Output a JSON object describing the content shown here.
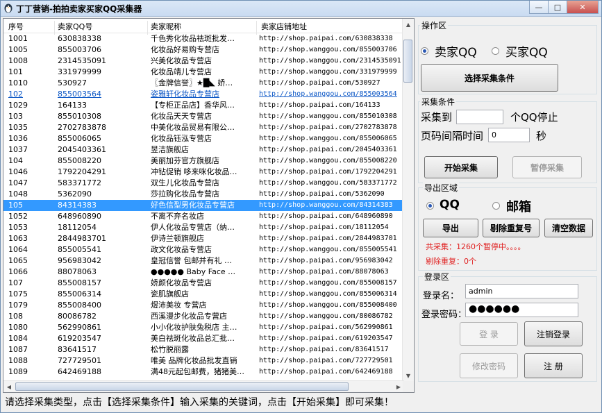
{
  "window": {
    "title": "丁丁营销-拍拍卖家买家QQ采集器"
  },
  "table": {
    "headers": [
      "序号",
      "卖家QQ号",
      "卖家昵称",
      "卖家店铺地址"
    ],
    "rows": [
      [
        "1001",
        "630838338",
        "千色秀化妆品祛斑批发…",
        "http://shop.paipai.com/630838338"
      ],
      [
        "1005",
        "855003706",
        "化妆品好易购专营店",
        "http://shop.wanggou.com/855003706"
      ],
      [
        "1008",
        "2314535091",
        "兴美化妆品专营店",
        "http://shop.wanggou.com/2314535091"
      ],
      [
        "101",
        "331979999",
        "化妆品靖儿专营店",
        "http://shop.wanggou.com/331979999"
      ],
      [
        "1010",
        "530927",
        "〖金牌信誉〗★█◣ 娇…",
        "http://shop.paipai.com/530927"
      ],
      [
        "102",
        "855003564",
        "姿雅轩化妆品专营店",
        "http://shop.wanggou.com/855003564"
      ],
      [
        "1029",
        "164133",
        "【专柜正品店】香华风…",
        "http://shop.paipai.com/164133"
      ],
      [
        "103",
        "855010308",
        "化妆品天天专营店",
        "http://shop.wanggou.com/855010308"
      ],
      [
        "1035",
        "2702783878",
        "中美化妆品贸易有限公…",
        "http://shop.paipai.com/2702783878"
      ],
      [
        "1036",
        "855006065",
        "化妆品钰泓专营店",
        "http://shop.wanggou.com/855006065"
      ],
      [
        "1037",
        "2045403361",
        "昱洁旗舰店",
        "http://shop.paipai.com/2045403361"
      ],
      [
        "104",
        "855008220",
        "美丽加芬官方旗舰店",
        "http://shop.wanggou.com/855008220"
      ],
      [
        "1046",
        "1792204291",
        "冲钻促销 哆来咪化妆品…",
        "http://shop.paipai.com/1792204291"
      ],
      [
        "1047",
        "583371772",
        "双生儿化妆品专营店",
        "http://shop.wanggou.com/583371772"
      ],
      [
        "1048",
        "5362090",
        "莎拉购化妆品专营店",
        "http://shop.paipai.com/5362090"
      ],
      [
        "105",
        "84314383",
        "好色信型男化妆品专营店",
        "http://shop.wanggou.com/84314383"
      ],
      [
        "1052",
        "648960890",
        "不离不弃名妆店",
        "http://shop.paipai.com/648960890"
      ],
      [
        "1053",
        "18112054",
        "伊人化妆品专营店（纳…",
        "http://shop.paipai.com/18112054"
      ],
      [
        "1063",
        "2844983701",
        "伊诗兰顿旗舰店",
        "http://shop.paipai.com/2844983701"
      ],
      [
        "1064",
        "855005541",
        "政文化妆品专营店",
        "http://shop.wanggou.com/855005541"
      ],
      [
        "1065",
        "956983042",
        "皇冠信誉 包邮并有礼 …",
        "http://shop.paipai.com/956983042"
      ],
      [
        "1066",
        "88078063",
        "●●●●● Baby Face …",
        "http://shop.paipai.com/88078063"
      ],
      [
        "107",
        "855008157",
        "娇颜化妆品专营店",
        "http://shop.wanggou.com/855008157"
      ],
      [
        "1075",
        "855006314",
        "瓷肌旗舰店",
        "http://shop.wanggou.com/855006314"
      ],
      [
        "1079",
        "855008400",
        "煜沛美妆 专营店",
        "http://shop.wanggou.com/855008400"
      ],
      [
        "108",
        "80086782",
        "西溪漫步化妆品专营店",
        "http://shop.wanggou.com/80086782"
      ],
      [
        "1080",
        "562990861",
        "小小化妆护肤兔税店 主…",
        "http://shop.paipai.com/562990861"
      ],
      [
        "1084",
        "619203547",
        "美白祛斑化妆品总汇批…",
        "http://shop.paipai.com/619203547"
      ],
      [
        "1087",
        "83641517",
        "松竹脱丽露",
        "http://shop.paipai.com/83641517"
      ],
      [
        "1088",
        "727729501",
        "唯美 品牌化妆品批发直销",
        "http://shop.paipai.com/727729501"
      ],
      [
        "1089",
        "642469188",
        "满48元起包邮费，猪猪美…",
        "http://shop.paipai.com/642469188"
      ]
    ]
  },
  "ops": {
    "group_label": "操作区",
    "radio_seller": "卖家QQ",
    "radio_buyer": "买家QQ",
    "selected": "seller",
    "choose_button": "选择采集条件"
  },
  "collect": {
    "group_label": "采集条件",
    "collect_to_label": "采集到",
    "collect_to_value": "",
    "collect_to_suffix": "个QQ停止",
    "interval_label": "页码间隔时间",
    "interval_value": "0",
    "interval_suffix": "秒",
    "start_button": "开始采集",
    "pause_button": "暂停采集"
  },
  "export": {
    "group_label": "导出区域",
    "radio_qq": "QQ",
    "radio_mail": "邮箱",
    "selected": "qq",
    "export_button": "导出",
    "dedupe_button": "剔除重复号",
    "clear_button": "清空数据",
    "status_collected": "共采集：1260个暂停中。。。。",
    "status_dupes": "剔除重复：0个"
  },
  "login": {
    "group_label": "登录区",
    "username_label": "登录名：",
    "username_value": "admin",
    "password_label": "登录密码：",
    "password_value": "●●●●●●",
    "login_button": "登 录",
    "logout_button": "注销登录",
    "change_pw_button": "修改密码",
    "register_button": "注 册"
  },
  "status_bar": {
    "text": "请选择采集类型，点击【选择采集条件】输入采集的关键词，点击【开始采集】即可采集！"
  },
  "colors": {
    "selection": "#3399ff",
    "link": "#0b56c5",
    "status_red": "#e02020"
  }
}
